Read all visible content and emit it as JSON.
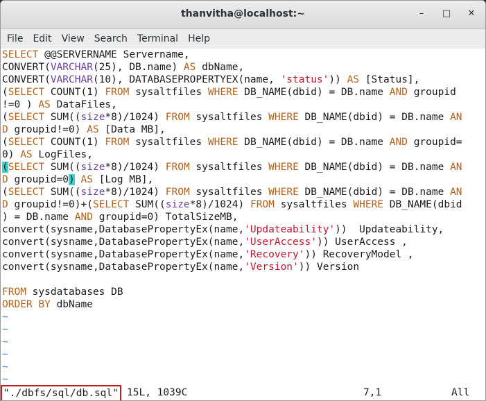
{
  "window": {
    "title": "thanvitha@localhost:~",
    "min_glyph": "–",
    "max_glyph": "□",
    "close_glyph": "✕"
  },
  "menu": [
    "File",
    "Edit",
    "View",
    "Search",
    "Terminal",
    "Help"
  ],
  "code": [
    [
      [
        "SELECT",
        "kw"
      ],
      [
        " @@SERVERNAME Servername,",
        ""
      ]
    ],
    [
      [
        "CONVERT(",
        ""
      ],
      [
        "VARCHAR",
        "ty"
      ],
      [
        "(25), DB.name) ",
        ""
      ],
      [
        "AS",
        "kw"
      ],
      [
        " dbName,",
        ""
      ]
    ],
    [
      [
        "CONVERT(",
        ""
      ],
      [
        "VARCHAR",
        "ty"
      ],
      [
        "(10), DATABASEPROPERTYEX(name, ",
        ""
      ],
      [
        "'status'",
        "str"
      ],
      [
        ")) ",
        ""
      ],
      [
        "AS",
        "kw"
      ],
      [
        " [Status],",
        ""
      ]
    ],
    [
      [
        "(",
        ""
      ],
      [
        "SELECT",
        "kw"
      ],
      [
        " COUNT(1) ",
        ""
      ],
      [
        "FROM",
        "kw"
      ],
      [
        " sysaltfiles ",
        ""
      ],
      [
        "WHERE",
        "kw"
      ],
      [
        " DB_NAME(dbid) = DB.name ",
        ""
      ],
      [
        "AND",
        "kw"
      ],
      [
        " groupid",
        ""
      ]
    ],
    [
      [
        "!=0 ) ",
        ""
      ],
      [
        "AS",
        "kw"
      ],
      [
        " DataFiles,",
        ""
      ]
    ],
    [
      [
        "(",
        ""
      ],
      [
        "SELECT",
        "kw"
      ],
      [
        " SUM((",
        ""
      ],
      [
        "size",
        "ty"
      ],
      [
        "*8)/1024) ",
        ""
      ],
      [
        "FROM",
        "kw"
      ],
      [
        " sysaltfiles ",
        ""
      ],
      [
        "WHERE",
        "kw"
      ],
      [
        " DB_NAME(dbid) = DB.name ",
        ""
      ],
      [
        "AN",
        "kw"
      ]
    ],
    [
      [
        "D",
        "kw"
      ],
      [
        " groupid!=0) ",
        ""
      ],
      [
        "AS",
        "kw"
      ],
      [
        " [Data MB],",
        ""
      ]
    ],
    [
      [
        "(",
        ""
      ],
      [
        "SELECT",
        "kw"
      ],
      [
        " COUNT(1) ",
        ""
      ],
      [
        "FROM",
        "kw"
      ],
      [
        " sysaltfiles ",
        ""
      ],
      [
        "WHERE",
        "kw"
      ],
      [
        " DB_NAME(dbid) = DB.name ",
        ""
      ],
      [
        "AND",
        "kw"
      ],
      [
        " groupid=",
        ""
      ]
    ],
    [
      [
        "0) ",
        ""
      ],
      [
        "AS",
        "kw"
      ],
      [
        " LogFiles,",
        ""
      ]
    ],
    [
      [
        "(",
        "hl"
      ],
      [
        "SELECT",
        "kw"
      ],
      [
        " SUM((",
        ""
      ],
      [
        "size",
        "ty"
      ],
      [
        "*8)/1024) ",
        ""
      ],
      [
        "FROM",
        "kw"
      ],
      [
        " sysaltfiles ",
        ""
      ],
      [
        "WHERE",
        "kw"
      ],
      [
        " DB_NAME(dbid) = DB.name ",
        ""
      ],
      [
        "AN",
        "kw"
      ]
    ],
    [
      [
        "D",
        "kw"
      ],
      [
        " groupid=0",
        ""
      ],
      [
        ")",
        "hl"
      ],
      [
        " ",
        ""
      ],
      [
        "AS",
        "kw"
      ],
      [
        " [Log MB],",
        ""
      ]
    ],
    [
      [
        "(",
        ""
      ],
      [
        "SELECT",
        "kw"
      ],
      [
        " SUM((",
        ""
      ],
      [
        "size",
        "ty"
      ],
      [
        "*8)/1024) ",
        ""
      ],
      [
        "FROM",
        "kw"
      ],
      [
        " sysaltfiles ",
        ""
      ],
      [
        "WHERE",
        "kw"
      ],
      [
        " DB_NAME(dbid) = DB.name ",
        ""
      ],
      [
        "AN",
        "kw"
      ]
    ],
    [
      [
        "D",
        "kw"
      ],
      [
        " groupid!=0)+(",
        ""
      ],
      [
        "SELECT",
        "kw"
      ],
      [
        " SUM((",
        ""
      ],
      [
        "size",
        "ty"
      ],
      [
        "*8)/1024) ",
        ""
      ],
      [
        "FROM",
        "kw"
      ],
      [
        " sysaltfiles ",
        ""
      ],
      [
        "WHERE",
        "kw"
      ],
      [
        " DB_NAME(dbid",
        ""
      ]
    ],
    [
      [
        ") = DB.name ",
        ""
      ],
      [
        "AND",
        "kw"
      ],
      [
        " groupid=0) TotalSizeMB,",
        ""
      ]
    ],
    [
      [
        "convert(sysname,DatabasePropertyEx(name,",
        ""
      ],
      [
        "'Updateability'",
        "str"
      ],
      [
        "))  Updateability,",
        ""
      ]
    ],
    [
      [
        "convert(sysname,DatabasePropertyEx(name,",
        ""
      ],
      [
        "'UserAccess'",
        "str"
      ],
      [
        ")) UserAccess ,",
        ""
      ]
    ],
    [
      [
        "convert(sysname,DatabasePropertyEx(name,",
        ""
      ],
      [
        "'Recovery'",
        "str"
      ],
      [
        ")) RecoveryModel ,",
        ""
      ]
    ],
    [
      [
        "convert(sysname,DatabasePropertyEx(name,",
        ""
      ],
      [
        "'Version'",
        "str"
      ],
      [
        ")) Version",
        ""
      ]
    ],
    [],
    [
      [
        "FROM",
        "kw"
      ],
      [
        " sysdatabases DB",
        ""
      ]
    ],
    [
      [
        "ORDER BY",
        "kw"
      ],
      [
        " dbName",
        ""
      ]
    ],
    [
      [
        "~",
        "tilde"
      ]
    ],
    [
      [
        "~",
        "tilde"
      ]
    ],
    [
      [
        "~",
        "tilde"
      ]
    ],
    [
      [
        "~",
        "tilde"
      ]
    ],
    [
      [
        "~",
        "tilde"
      ]
    ],
    [
      [
        "~",
        "tilde"
      ]
    ]
  ],
  "status": {
    "filename": "\"./dbfs/sql/db.sql\"",
    "info": "15L, 1039C",
    "cursor": "7,1",
    "scroll": "All"
  }
}
